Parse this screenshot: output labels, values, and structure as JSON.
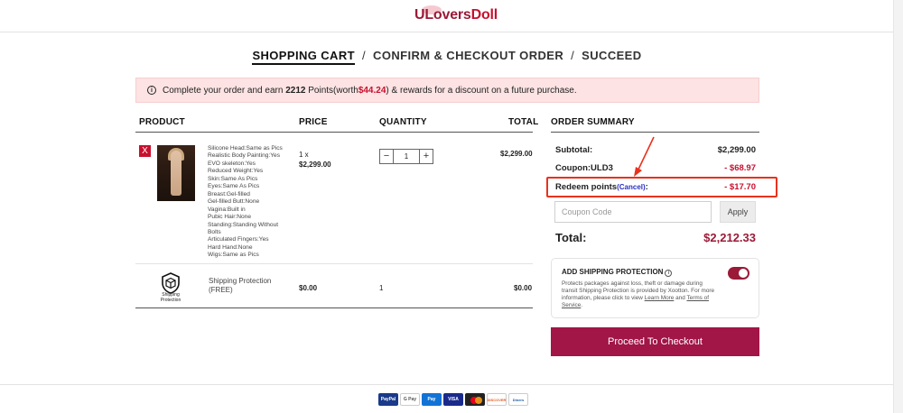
{
  "brand": {
    "logo_first": "ULovers",
    "logo_rest": "Doll"
  },
  "steps": {
    "cart": "SHOPPING CART",
    "sep": "/",
    "confirm": "CONFIRM & CHECKOUT ORDER",
    "succeed": "SUCCEED"
  },
  "notice": {
    "prefix": "Complete your order and earn",
    "points": "2212",
    "points_word": "Points(worth",
    "worth": "$44.24",
    "suffix": ") & rewards for a discount on a future purchase."
  },
  "table_headers": {
    "product": "PRODUCT",
    "price": "PRICE",
    "quantity": "QUANTITY",
    "total": "TOTAL",
    "order_summary": "ORDER SUMMARY"
  },
  "item": {
    "remove": "X",
    "specs": [
      "Silicone Head:Same as Pics",
      "Realistic Body Painting:Yes",
      "EVO skeleton:Yes",
      "Reduced Weight:Yes",
      "Skin:Same As Pics",
      "Eyes:Same As Pics",
      "Breast:Gel-filled",
      "Gel-filled Butt:None",
      "Vagina:Built in",
      "Pubic Hair:None",
      "Standing:Standing Without",
      "Bolts",
      "Articulated Fingers:Yes",
      "Hard Hand:None",
      "Wigs:Same as Pics"
    ],
    "qty_prefix": "1 x",
    "unit_price": "$2,299.00",
    "qty_minus": "−",
    "qty": "1",
    "qty_plus": "+",
    "total": "$2,299.00"
  },
  "shipping_item": {
    "icon_label": "Shipping Protection",
    "name": "Shipping Protection",
    "sub": "(FREE)",
    "price": "$0.00",
    "qty": "1",
    "total": "$0.00"
  },
  "summary": {
    "subtotal_label": "Subtotal:",
    "subtotal": "$2,299.00",
    "coupon_label": "Coupon:ULD3",
    "coupon": "- $68.97",
    "redeem_label": "Redeem points",
    "redeem_cancel": "(Cancel)",
    "redeem_colon": ":",
    "redeem": "- $17.70",
    "coupon_placeholder": "Coupon Code",
    "apply": "Apply",
    "total_label": "Total:",
    "total": "$2,212.33"
  },
  "shipping_protection": {
    "title": "ADD SHIPPING PROTECTION",
    "info": "i",
    "desc_main": "Protects packages against loss, theft or damage during transit Shipping Protection is provided by Xootton. For more information, please click to view",
    "learn_more": "Learn More",
    "and": "and",
    "terms": "Terms of Service",
    "period": ".",
    "enabled": true
  },
  "checkout_label": "Proceed To Checkout",
  "payments": [
    "PayPal",
    "G Pay",
    "Pay",
    "VISA",
    "",
    "DISCOVER",
    "Diners"
  ],
  "colors": {
    "accent": "#a11547",
    "highlight_red": "#c8102e",
    "annotation": "#e8321e",
    "link": "#2a2ec0"
  }
}
